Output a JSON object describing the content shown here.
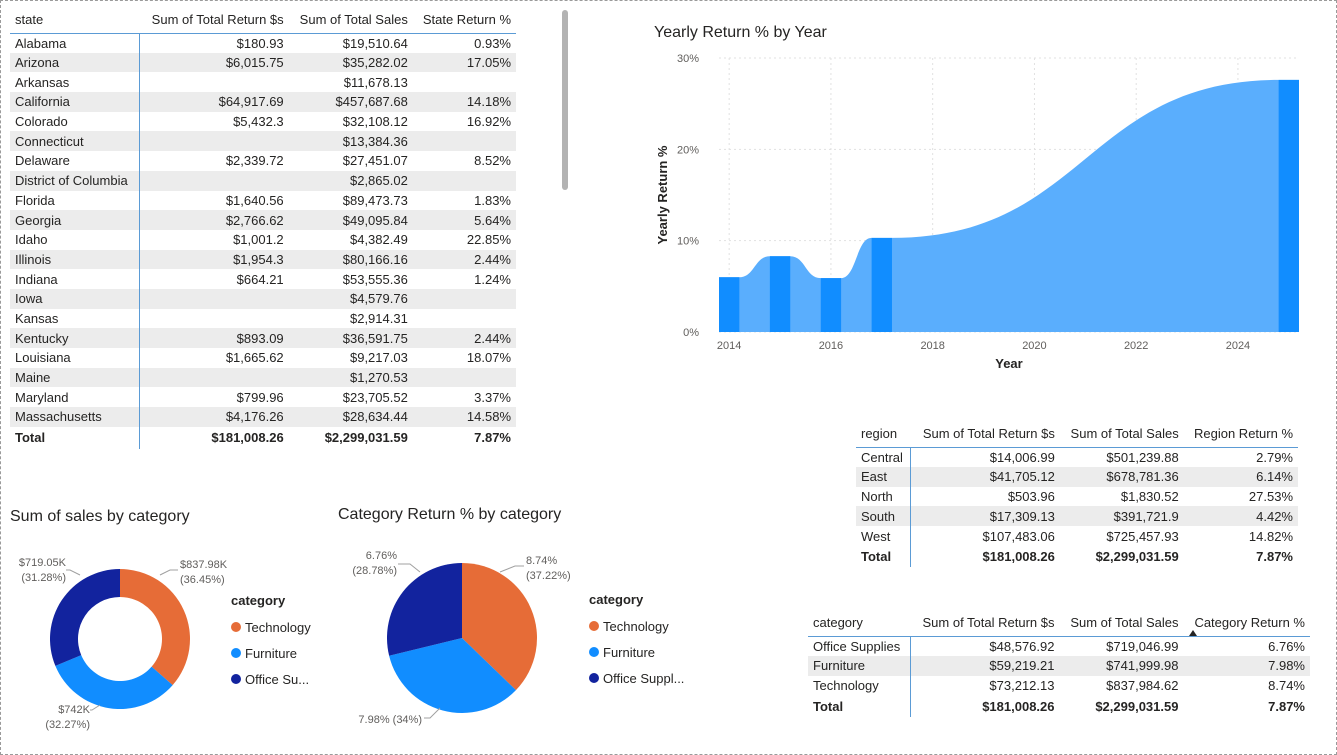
{
  "state_table": {
    "headers": [
      "state",
      "Sum of Total Return $s",
      "Sum of Total Sales",
      "State Return %"
    ],
    "rows": [
      [
        "Alabama",
        "$180.93",
        "$19,510.64",
        "0.93%"
      ],
      [
        "Arizona",
        "$6,015.75",
        "$35,282.02",
        "17.05%"
      ],
      [
        "Arkansas",
        "",
        "$11,678.13",
        ""
      ],
      [
        "California",
        "$64,917.69",
        "$457,687.68",
        "14.18%"
      ],
      [
        "Colorado",
        "$5,432.3",
        "$32,108.12",
        "16.92%"
      ],
      [
        "Connecticut",
        "",
        "$13,384.36",
        ""
      ],
      [
        "Delaware",
        "$2,339.72",
        "$27,451.07",
        "8.52%"
      ],
      [
        "District of Columbia",
        "",
        "$2,865.02",
        ""
      ],
      [
        "Florida",
        "$1,640.56",
        "$89,473.73",
        "1.83%"
      ],
      [
        "Georgia",
        "$2,766.62",
        "$49,095.84",
        "5.64%"
      ],
      [
        "Idaho",
        "$1,001.2",
        "$4,382.49",
        "22.85%"
      ],
      [
        "Illinois",
        "$1,954.3",
        "$80,166.16",
        "2.44%"
      ],
      [
        "Indiana",
        "$664.21",
        "$53,555.36",
        "1.24%"
      ],
      [
        "Iowa",
        "",
        "$4,579.76",
        ""
      ],
      [
        "Kansas",
        "",
        "$2,914.31",
        ""
      ],
      [
        "Kentucky",
        "$893.09",
        "$36,591.75",
        "2.44%"
      ],
      [
        "Louisiana",
        "$1,665.62",
        "$9,217.03",
        "18.07%"
      ],
      [
        "Maine",
        "",
        "$1,270.53",
        ""
      ],
      [
        "Maryland",
        "$799.96",
        "$23,705.52",
        "3.37%"
      ],
      [
        "Massachusetts",
        "$4,176.26",
        "$28,634.44",
        "14.58%"
      ]
    ],
    "total": [
      "Total",
      "$181,008.26",
      "$2,299,031.59",
      "7.87%"
    ]
  },
  "region_table": {
    "headers": [
      "region",
      "Sum of Total Return $s",
      "Sum of Total Sales",
      "Region Return %"
    ],
    "rows": [
      [
        "Central",
        "$14,006.99",
        "$501,239.88",
        "2.79%"
      ],
      [
        "East",
        "$41,705.12",
        "$678,781.36",
        "6.14%"
      ],
      [
        "North",
        "$503.96",
        "$1,830.52",
        "27.53%"
      ],
      [
        "South",
        "$17,309.13",
        "$391,721.9",
        "4.42%"
      ],
      [
        "West",
        "$107,483.06",
        "$725,457.93",
        "14.82%"
      ]
    ],
    "total": [
      "Total",
      "$181,008.26",
      "$2,299,031.59",
      "7.87%"
    ]
  },
  "category_table": {
    "headers": [
      "category",
      "Sum of Total Return $s",
      "Sum of Total Sales",
      "Category Return %"
    ],
    "rows": [
      [
        "Office Supplies",
        "$48,576.92",
        "$719,046.99",
        "6.76%"
      ],
      [
        "Furniture",
        "$59,219.21",
        "$741,999.98",
        "7.98%"
      ],
      [
        "Technology",
        "$73,212.13",
        "$837,984.62",
        "8.74%"
      ]
    ],
    "total": [
      "Total",
      "$181,008.26",
      "$2,299,031.59",
      "7.87%"
    ]
  },
  "colors": {
    "technology": "#e66c37",
    "furniture": "#118dff",
    "office_supplies": "#12239e",
    "area_fill": "#5aaefd",
    "area_bar": "#118dff",
    "grid": "#e1e1e1"
  },
  "chart_data": [
    {
      "type": "area",
      "title": "Yearly Return % by Year",
      "xlabel": "Year",
      "ylabel": "Yearly Return %",
      "x_ticks": [
        "2014",
        "2016",
        "2018",
        "2020",
        "2022",
        "2024"
      ],
      "y_ticks": [
        "0%",
        "10%",
        "20%",
        "30%"
      ],
      "ylim": [
        0,
        30
      ],
      "xlim": [
        2013.8,
        2025.2
      ],
      "series": [
        {
          "x": [
            2014,
            2015,
            2016,
            2017,
            2025
          ],
          "values": [
            6.0,
            8.3,
            5.9,
            10.3,
            27.6
          ]
        }
      ],
      "grid": true
    },
    {
      "type": "pie",
      "title": "Sum of sales by category",
      "donut": true,
      "categories": [
        "Technology",
        "Furniture",
        "Office Supplies"
      ],
      "values": [
        837.98,
        742,
        719.05
      ],
      "value_labels": [
        "$837.98K",
        "$742K",
        "$719.05K"
      ],
      "percent_labels": [
        "(36.45%)",
        "(32.27%)",
        "(31.28%)"
      ],
      "legend_title": "category",
      "legend_labels": [
        "Technology",
        "Furniture",
        "Office Su..."
      ]
    },
    {
      "type": "pie",
      "title": "Category Return % by category",
      "donut": false,
      "categories": [
        "Technology",
        "Furniture",
        "Office Supplies"
      ],
      "values": [
        8.74,
        7.98,
        6.76
      ],
      "value_labels": [
        "8.74%",
        "7.98% (34%)",
        "6.76%"
      ],
      "percent_labels": [
        "(37.22%)",
        "",
        "(28.78%)"
      ],
      "legend_title": "category",
      "legend_labels": [
        "Technology",
        "Furniture",
        "Office Suppl..."
      ]
    }
  ]
}
